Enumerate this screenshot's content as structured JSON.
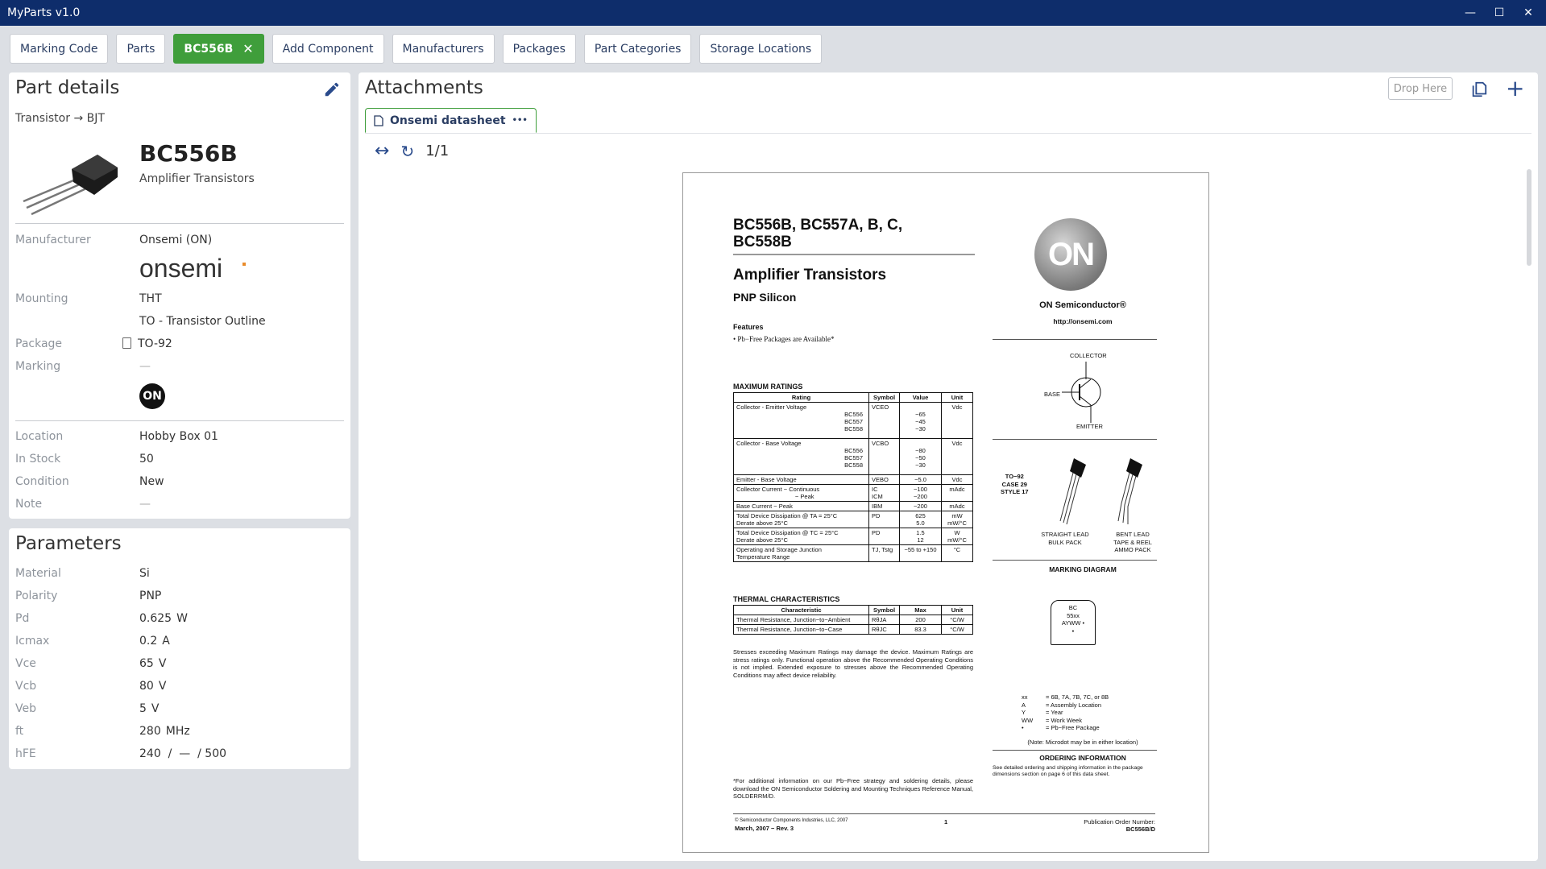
{
  "window": {
    "title": "MyParts v1.0"
  },
  "tabs": [
    {
      "label": "Marking Code"
    },
    {
      "label": "Parts"
    },
    {
      "label": "BC556B",
      "active": true
    },
    {
      "label": "Add Component"
    },
    {
      "label": "Manufacturers"
    },
    {
      "label": "Packages"
    },
    {
      "label": "Part Categories"
    },
    {
      "label": "Storage Locations"
    }
  ],
  "part_details": {
    "title": "Part details",
    "breadcrumb": "Transistor → BJT",
    "name": "BC556B",
    "description": "Amplifier Transistors",
    "manufacturer_label": "Manufacturer",
    "manufacturer_value": "Onsemi (ON)",
    "manufacturer_logo_text": "onsemi",
    "mounting_label": "Mounting",
    "mounting_value": "THT",
    "mounting_sub": "TO - Transistor Outline",
    "package_label": "Package",
    "package_value": "TO-92",
    "marking_label": "Marking",
    "marking_value": "—",
    "marking_badge": "ON",
    "location_label": "Location",
    "location_value": "Hobby Box 01",
    "stock_label": "In Stock",
    "stock_value": "50",
    "condition_label": "Condition",
    "condition_value": "New",
    "note_label": "Note",
    "note_value": "—"
  },
  "parameters": {
    "title": "Parameters",
    "rows": [
      {
        "label": "Material",
        "value": "Si",
        "unit": ""
      },
      {
        "label": "Polarity",
        "value": "PNP",
        "unit": ""
      },
      {
        "label": "Pd",
        "value": "0.625",
        "unit": "W"
      },
      {
        "label": "Icmax",
        "value": "0.2",
        "unit": "A"
      },
      {
        "label": "Vce",
        "value": "65",
        "unit": "V"
      },
      {
        "label": "Vcb",
        "value": "80",
        "unit": "V"
      },
      {
        "label": "Veb",
        "value": "5",
        "unit": "V"
      },
      {
        "label": "ft",
        "value": "280",
        "unit": "MHz"
      },
      {
        "label": "hFE",
        "value": "240  /  —  / 500",
        "unit": ""
      }
    ]
  },
  "attachments": {
    "title": "Attachments",
    "drop_here": "Drop Here",
    "tab_label": "Onsemi datasheet",
    "tab_menu": "•••",
    "page_count": "1/1"
  },
  "pdf": {
    "title_line1": "BC556B, BC557A, B, C,",
    "title_line2": "BC558B",
    "subtitle": "Amplifier Transistors",
    "subtitle2": "PNP Silicon",
    "features_head": "Features",
    "features_item": "•  Pb−Free Packages are Available*",
    "max_ratings_head": "MAXIMUM RATINGS",
    "thermal_head": "THERMAL CHARACTERISTICS",
    "stress_note": "Stresses exceeding Maximum Ratings may damage the device. Maximum Ratings are stress ratings only. Functional operation above the Recommended Operating Conditions is not implied. Extended exposure to stresses above the Recommended Operating Conditions may affect device reliability.",
    "footnote": "*For additional information on our Pb−Free strategy and soldering details, please download the ON Semiconductor Soldering and Mounting Techniques Reference Manual, SOLDERRM/D.",
    "on_logo": "ON",
    "brand": "ON Semiconductor®",
    "url": "http://onsemi.com",
    "collector": "COLLECTOR",
    "base": "BASE",
    "emitter": "EMITTER",
    "pkg_text": "TO−92\nCASE 29\nSTYLE 17",
    "straight_lead": "STRAIGHT LEAD\nBULK PACK",
    "bent_lead": "BENT LEAD\nTAPE & REEL\nAMMO PACK",
    "marking_diagram": "MARKING DIAGRAM",
    "marking_chip": "BC\n55xx\nAYWW •\n•",
    "legend": [
      {
        "k": "xx",
        "v": "= 6B, 7A, 7B, 7C, or 8B"
      },
      {
        "k": "A",
        "v": "= Assembly Location"
      },
      {
        "k": "Y",
        "v": "= Year"
      },
      {
        "k": "WW",
        "v": "= Work Week"
      },
      {
        "k": "•",
        "v": "= Pb−Free Package"
      }
    ],
    "microdot_note": "(Note: Microdot may be in either location)",
    "ordering_head": "ORDERING INFORMATION",
    "ordering_text": "See detailed ordering and shipping information in the package dimensions section on page 6 of this data sheet.",
    "copyright": "©  Semiconductor Components Industries, LLC, 2007",
    "date_rev": "March, 2007 − Rev. 3",
    "page_num": "1",
    "pub_label": "Publication Order Number:",
    "pub_num": "BC556B/D",
    "ratings_header": [
      "Rating",
      "Symbol",
      "Value",
      "Unit"
    ],
    "ratings": [
      {
        "rating": "Collector - Emitter Voltage",
        "sub": "BC556\nBC557\nBC558",
        "symbol": "VCEO",
        "value": "\n−65\n−45\n−30",
        "unit": "Vdc"
      },
      {
        "rating": "Collector - Base Voltage",
        "sub": "BC556\nBC557\nBC558",
        "symbol": "VCBO",
        "value": "\n−80\n−50\n−30",
        "unit": "Vdc"
      },
      {
        "rating": "Emitter - Base Voltage",
        "sub": "",
        "symbol": "VEBO",
        "value": "−5.0",
        "unit": "Vdc"
      },
      {
        "rating": "Collector Current − Continuous\n                                   − Peak",
        "sub": "",
        "symbol": "IC\nICM",
        "value": "−100\n−200",
        "unit": "mAdc"
      },
      {
        "rating": "Base Current − Peak",
        "sub": "",
        "symbol": "IBM",
        "value": "−200",
        "unit": "mAdc"
      },
      {
        "rating": "Total Device Dissipation @ TA = 25°C\nDerate above 25°C",
        "sub": "",
        "symbol": "PD",
        "value": "625\n5.0",
        "unit": "mW\nmW/°C"
      },
      {
        "rating": "Total Device Dissipation @ TC = 25°C\nDerate above 25°C",
        "sub": "",
        "symbol": "PD",
        "value": "1.5\n12",
        "unit": "W\nmW/°C"
      },
      {
        "rating": "Operating and Storage Junction\nTemperature Range",
        "sub": "",
        "symbol": "TJ, Tstg",
        "value": "−55 to +150",
        "unit": "°C"
      }
    ],
    "thermal_header": [
      "Characteristic",
      "Symbol",
      "Max",
      "Unit"
    ],
    "thermal": [
      {
        "c": "Thermal Resistance, Junction−to−Ambient",
        "s": "RθJA",
        "m": "200",
        "u": "°C/W"
      },
      {
        "c": "Thermal Resistance, Junction−to−Case",
        "s": "RθJC",
        "m": "83.3",
        "u": "°C/W"
      }
    ]
  },
  "colors": {
    "titlebar": "#0e2d6b",
    "active_tab": "#3f9e3b",
    "accent": "#2a4b8c",
    "label": "#8e949c"
  }
}
